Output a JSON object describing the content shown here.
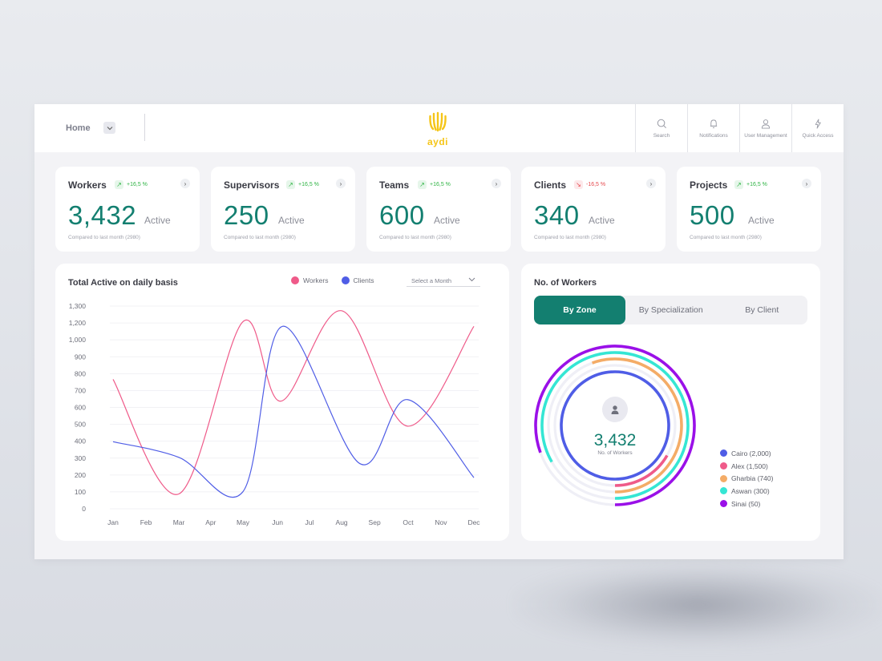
{
  "header": {
    "home_label": "Home",
    "logo_text": "aydi",
    "nav": [
      {
        "label": "Search",
        "icon": "search-icon"
      },
      {
        "label": "Notifications",
        "icon": "bell-icon"
      },
      {
        "label": "User Management",
        "icon": "user-icon"
      },
      {
        "label": "Quick Access",
        "icon": "bolt-icon"
      }
    ]
  },
  "stats": [
    {
      "title": "Workers",
      "change": "+16,5 %",
      "trend": "up",
      "value": "3,432",
      "unit": "Active",
      "compare": "Compared to last month (2980)"
    },
    {
      "title": "Supervisors",
      "change": "+16,5 %",
      "trend": "up",
      "value": "250",
      "unit": "Active",
      "compare": "Compared to last month (2980)"
    },
    {
      "title": "Teams",
      "change": "+16,5 %",
      "trend": "up",
      "value": "600",
      "unit": "Active",
      "compare": "Compared to last month (2980)"
    },
    {
      "title": "Clients",
      "change": "-16,5 %",
      "trend": "down",
      "value": "340",
      "unit": "Active",
      "compare": "Compared to last month (2980)"
    },
    {
      "title": "Projects",
      "change": "+16,5 %",
      "trend": "up",
      "value": "500",
      "unit": "Active",
      "compare": "Compared to last month (2980)"
    }
  ],
  "colors": {
    "accent": "#137f70",
    "up": "#2fb344",
    "down": "#e5484d",
    "workers_series": "#ef5a89",
    "clients_series": "#4f5de6"
  },
  "line_card": {
    "title": "Total Active on daily basis",
    "month_select_placeholder": "Select a Month"
  },
  "chart_data": {
    "type": "line",
    "title": "Total Active on daily basis",
    "categories": [
      "Jan",
      "Feb",
      "Mar",
      "Apr",
      "May",
      "Jun",
      "Jul",
      "Aug",
      "Sep",
      "Oct",
      "Nov",
      "Dec"
    ],
    "x": [
      0,
      1,
      2,
      2.97,
      3.95,
      5,
      5.97,
      6.95,
      7.95,
      8.97,
      9.97,
      10.97
    ],
    "series": [
      {
        "name": "Workers",
        "color": "#ef5a89",
        "points": [
          [
            0,
            830
          ],
          [
            2,
            95
          ],
          [
            3.95,
            1200
          ],
          [
            5.1,
            690
          ],
          [
            6.95,
            1270
          ],
          [
            8.95,
            530
          ],
          [
            10.97,
            1170
          ]
        ]
      },
      {
        "name": "Clients",
        "color": "#4f5de6",
        "points": [
          [
            0,
            430
          ],
          [
            2,
            330
          ],
          [
            3.95,
            110
          ],
          [
            5.15,
            1170
          ],
          [
            7.5,
            290
          ],
          [
            8.95,
            700
          ],
          [
            10.97,
            200
          ]
        ]
      }
    ],
    "yticks": [
      0,
      100,
      200,
      300,
      400,
      500,
      600,
      700,
      800,
      900,
      "1,000",
      "1,200",
      "1,300"
    ],
    "ylim": [
      0,
      1300
    ],
    "grid": true,
    "legend": "top"
  },
  "workers_card": {
    "title": "No. of Workers",
    "tabs": [
      "By Zone",
      "By Specialization",
      "By Client"
    ],
    "active_tab": 0,
    "total": "3,432",
    "total_label": "No. of Workers",
    "zones": [
      {
        "label": "Cairo (2,000)",
        "value": 2000,
        "color": "#4f5de6"
      },
      {
        "label": "Alex (1,500)",
        "value": 1500,
        "color": "#ef5a89"
      },
      {
        "label": "Gharbia (740)",
        "value": 740,
        "color": "#f4ac67"
      },
      {
        "label": "Aswan (300)",
        "value": 300,
        "color": "#35e6d4"
      },
      {
        "label": "Sinai (50)",
        "value": 50,
        "color": "#9a10e8"
      }
    ]
  }
}
